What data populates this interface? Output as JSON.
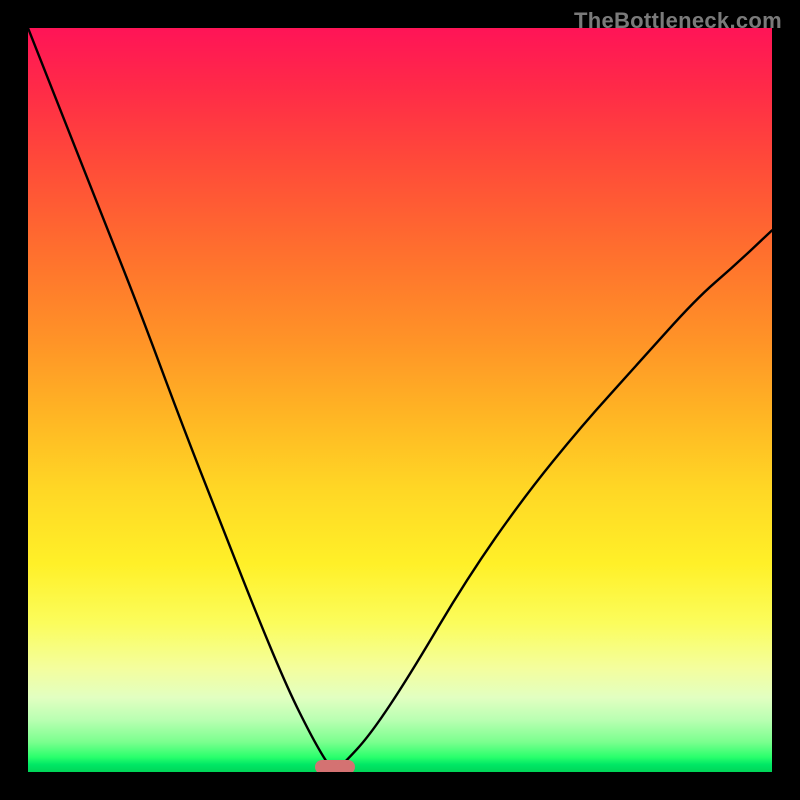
{
  "watermark": "TheBottleneck.com",
  "colors": {
    "frame": "#000000",
    "curve": "#000000",
    "marker": "#d47272",
    "watermark_text": "#7a7a7a",
    "gradient_stops": [
      "#ff1457",
      "#ff4a39",
      "#ff9327",
      "#ffd725",
      "#fbfd5c",
      "#b9ffb2",
      "#00d558"
    ]
  },
  "chart_data": {
    "type": "line",
    "title": "",
    "xlabel": "",
    "ylabel": "",
    "xlim": [
      0,
      1
    ],
    "ylim": [
      0,
      1
    ],
    "grid": false,
    "legend": false,
    "curve_description": "V-shaped bottleneck curve: two monotone branches descending from the top edges to a cusp near x≈0.41 at y≈0, right branch shallower than left",
    "x": [
      0.0,
      0.051,
      0.103,
      0.154,
      0.206,
      0.257,
      0.308,
      0.35,
      0.38,
      0.4,
      0.412,
      0.425,
      0.46,
      0.513,
      0.59,
      0.667,
      0.744,
      0.821,
      0.897,
      0.949,
      1.0
    ],
    "y": [
      1.0,
      0.87,
      0.74,
      0.61,
      0.47,
      0.34,
      0.21,
      0.11,
      0.05,
      0.015,
      0.0,
      0.012,
      0.05,
      0.13,
      0.26,
      0.37,
      0.465,
      0.55,
      0.635,
      0.68,
      0.728
    ],
    "marker": {
      "shape": "rounded-rect",
      "x": 0.412,
      "y": 0.0,
      "color": "#d47272"
    }
  }
}
